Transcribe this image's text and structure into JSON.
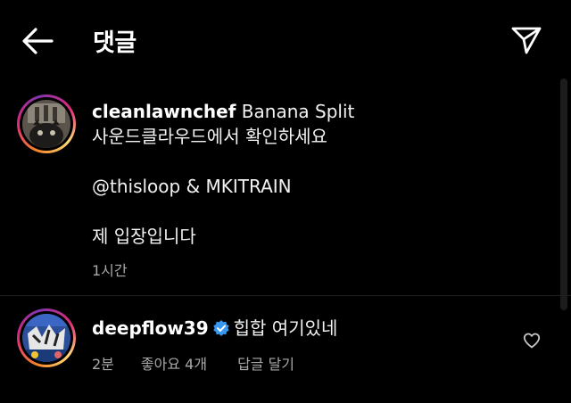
{
  "header": {
    "title": "댓글",
    "back_icon": "arrow-left-icon",
    "share_icon": "paper-plane-icon"
  },
  "caption": {
    "username": "cleanlawnchef",
    "line1_rest": " Banana Split",
    "line2": "사운드클라우드에서 확인하세요",
    "line3": "@thisloop & MKITRAIN",
    "line4": "제 입장입니다",
    "time": "1시간"
  },
  "comments": [
    {
      "username": "deepflow39",
      "verified": true,
      "text": "힙합 여기있네",
      "time": "2분",
      "likes": "좋아요 4개",
      "reply_label": "답글 달기"
    }
  ],
  "colors": {
    "background": "#000000",
    "text": "#f5f5f5",
    "meta": "#a8a8a8",
    "verified": "#3897f0"
  }
}
